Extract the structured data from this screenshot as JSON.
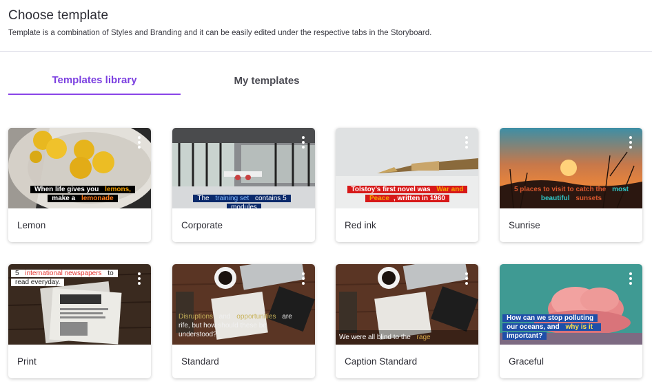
{
  "header": {
    "title": "Choose template",
    "subtitle": "Template is a combination of Styles and Branding and it can be easily edited under the respective tabs in the Storyboard."
  },
  "tabs": [
    {
      "label": "Templates library",
      "active": true
    },
    {
      "label": "My templates",
      "active": false
    }
  ],
  "colors": {
    "accent": "#8a44e8",
    "divider": "#dcdce6"
  },
  "templates": [
    {
      "name": "Lemon",
      "caption": {
        "a": "When life gives you ",
        "b": "lemons,",
        "c": "make a ",
        "d": "lemonade"
      }
    },
    {
      "name": "Corporate",
      "caption": {
        "a": "The ",
        "b": "training set",
        "c": " contains 5 modules"
      }
    },
    {
      "name": "Red ink",
      "caption": {
        "a": "Tolstoy’s first novel was ",
        "b": "War and Peace",
        "c": ", written in 1960"
      }
    },
    {
      "name": "Sunrise",
      "caption": {
        "a": "5 places to visit to catch the ",
        "b": "most beautiful",
        "c": " sunsets"
      }
    },
    {
      "name": "Print",
      "caption": {
        "a": "5 ",
        "b": "international newspapers",
        "c": " to read everyday."
      }
    },
    {
      "name": "Standard",
      "caption": {
        "a": "Disruptions",
        "b": " and ",
        "c": "opportunities",
        "d": " are rife, but how should these be understood?"
      }
    },
    {
      "name": "Caption Standard",
      "caption": {
        "a": "We were all blind to the ",
        "b": "rage"
      }
    },
    {
      "name": "Graceful",
      "caption": {
        "a": "How can we stop polluting our oceans, and ",
        "b": "why is it",
        "c": " important?"
      }
    }
  ],
  "icons": {
    "more": "kebab-menu-icon"
  }
}
